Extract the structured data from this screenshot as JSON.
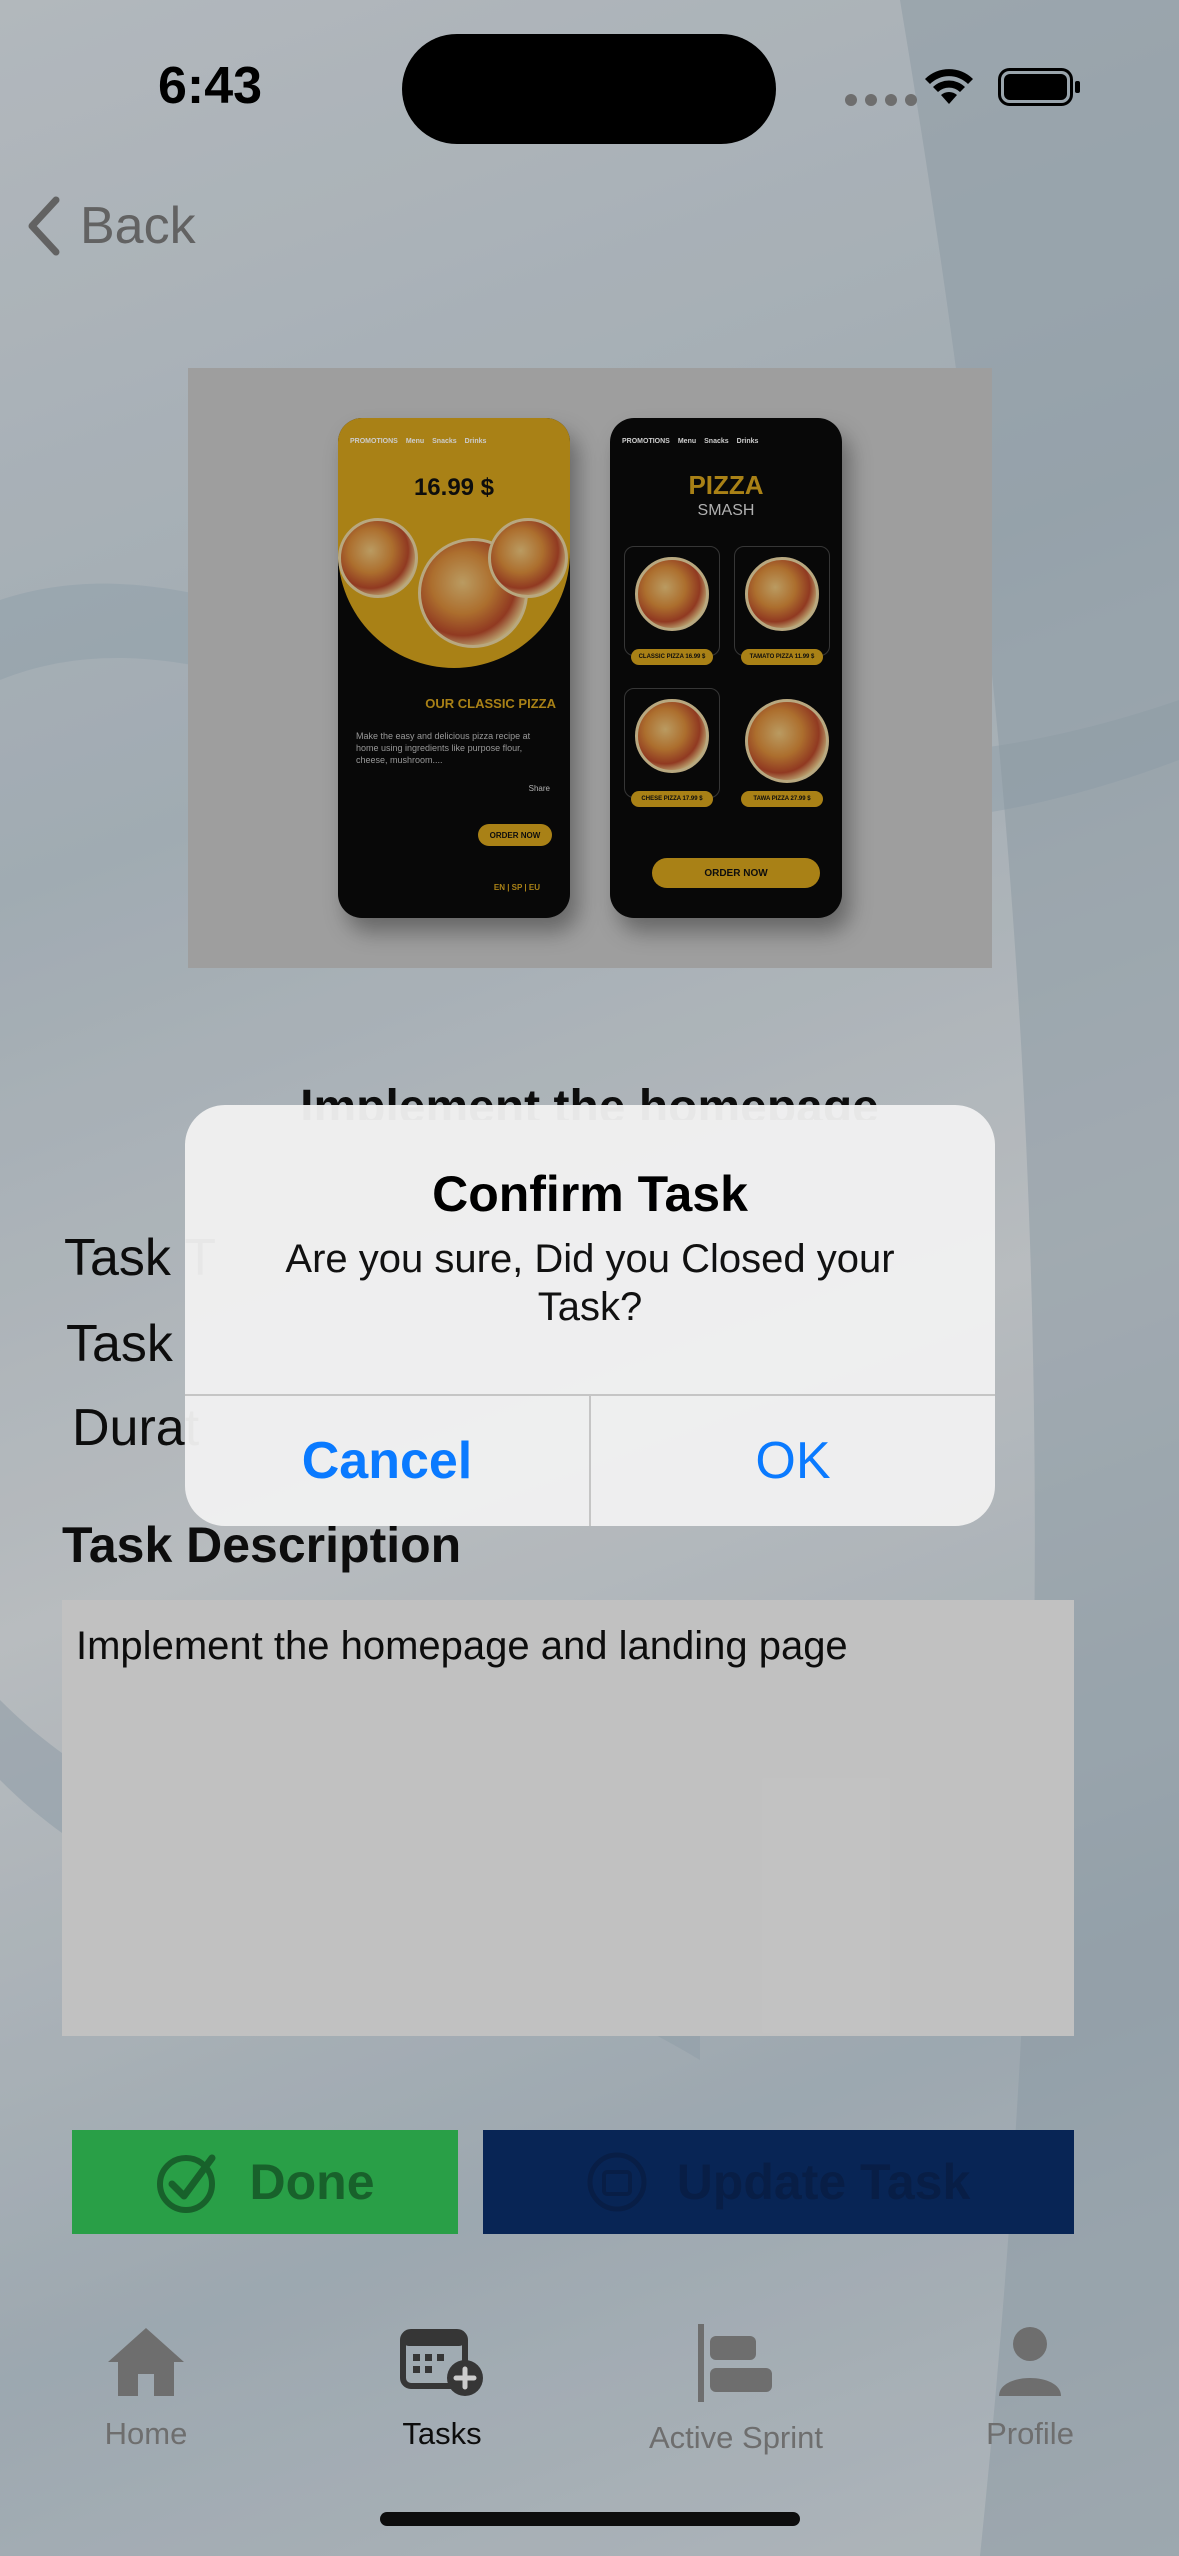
{
  "status_bar": {
    "time": "6:43"
  },
  "nav": {
    "back_label": "Back"
  },
  "preview": {
    "phone_a": {
      "nav_items": [
        "PROMOTIONS",
        "Menu",
        "Snacks",
        "Drinks"
      ],
      "price": "16.99 $",
      "heading": "OUR CLASSIC PIZZA",
      "text": "Make the easy and delicious pizza recipe at home using ingredients like purpose flour, cheese, mushroom....",
      "share": "Share",
      "order": "ORDER NOW",
      "lang": "EN | SP | EU"
    },
    "phone_b": {
      "nav_items": [
        "PROMOTIONS",
        "Menu",
        "Snacks",
        "Drinks"
      ],
      "title": "PIZZA",
      "subtitle": "SMASH",
      "tiles": [
        "CLASSIC PIZZA 16.99 $",
        "TAMATO PIZZA 11.99 $",
        "CHESE PIZZA 17.99 $",
        "TAWA PIZZA 27.99 $"
      ],
      "order": "ORDER NOW"
    }
  },
  "task": {
    "title": "Implement the homepage",
    "row_labels": [
      "Task T",
      "Task",
      "Durat"
    ],
    "description_label": "Task Description",
    "description": "Implement the homepage and landing page",
    "done_label": "Done",
    "update_label": "Update Task"
  },
  "tabs": [
    {
      "label": "Home",
      "icon": "house-icon",
      "active": false
    },
    {
      "label": "Tasks",
      "icon": "calendar-add-icon",
      "active": true
    },
    {
      "label": "Active Sprint",
      "icon": "sprint-bars-icon",
      "active": false
    },
    {
      "label": "Profile",
      "icon": "person-icon",
      "active": false
    }
  ],
  "alert": {
    "title": "Confirm Task",
    "message": "Are you sure, Did you Closed your Task?",
    "cancel": "Cancel",
    "ok": "OK"
  },
  "colors": {
    "accent": "#0a7aff",
    "done_green": "#34c759",
    "update_navy": "#0a2f6b",
    "pizza_gold": "#d4a21c"
  }
}
